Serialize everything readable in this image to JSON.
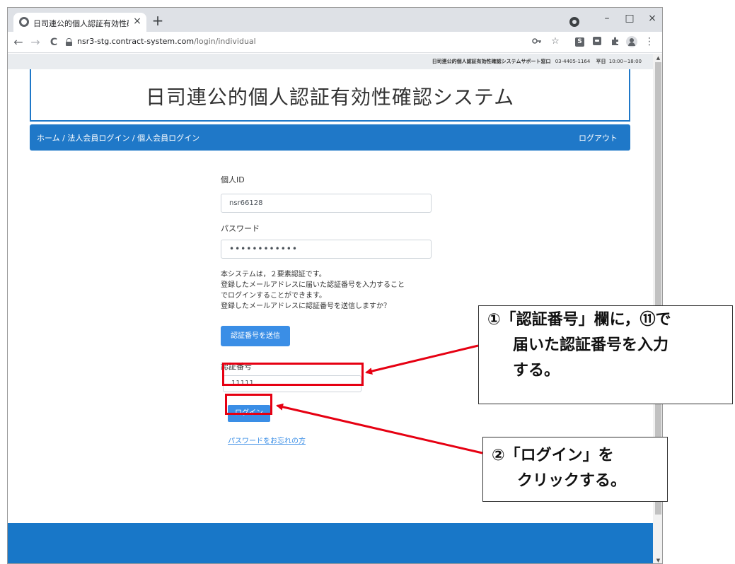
{
  "browser": {
    "tab_title": "日司連公的個人認証有効性確認シ",
    "tab_close": "×",
    "new_tab": "+",
    "minimize": "–",
    "maximize": "□",
    "close": "×",
    "back": "←",
    "forward": "→",
    "reload": "C",
    "url_host": "nsr3-stg.contract-system.com",
    "url_path": "/login/individual",
    "menu": "⋮"
  },
  "support_bar": {
    "label": "日司連公的個人認証有効性確認システムサポート窓口",
    "phone": "03-4405-1164",
    "hours_label": "平日",
    "hours": "10:00~18:00"
  },
  "header": {
    "title": "日司連公的個人認証有効性確認システム"
  },
  "nav": {
    "breadcrumb": "ホーム / 法人会員ログイン / 個人会員ログイン",
    "logout": "ログアウト"
  },
  "form": {
    "id_label": "個人ID",
    "id_value": "nsr66128",
    "password_label": "パスワード",
    "password_value": "••••••••••••",
    "notice_lines": [
      "本システムは，２要素認証です。",
      "登録したメールアドレスに届いた認証番号を入力すること",
      "でログインすることができます。",
      "登録したメールアドレスに認証番号を送信しますか？"
    ],
    "send_button": "認証番号を送信",
    "code_label": "認証番号",
    "code_value": "11111",
    "login_button": "ログイン",
    "forgot_link": "パスワードをお忘れの方"
  },
  "callouts": {
    "first": [
      "①「認証番号」欄に，⑪で",
      "届いた認証番号を入力",
      "する。"
    ],
    "second": [
      "②「ログイン」を",
      "クリックする。"
    ]
  },
  "colors": {
    "brand_blue": "#1f78c8",
    "button_blue": "#3a8ee6",
    "highlight_red": "#e60012"
  }
}
